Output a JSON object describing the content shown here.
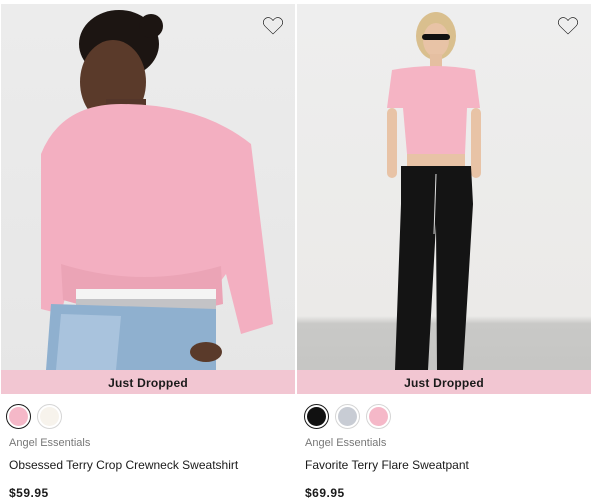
{
  "products": [
    {
      "badge": "Just Dropped",
      "brand": "Angel Essentials",
      "name": "Obsessed Terry Crop Crewneck Sweatshirt",
      "price": "$59.95",
      "favorite_icon": "heart-outline-icon",
      "swatches": [
        {
          "color": "#f5b8c8",
          "selected": true
        },
        {
          "color": "#f7f3ec",
          "selected": false
        }
      ]
    },
    {
      "badge": "Just Dropped",
      "brand": "Angel Essentials",
      "name": "Favorite Terry Flare Sweatpant",
      "price": "$69.95",
      "favorite_icon": "heart-outline-icon",
      "swatches": [
        {
          "color": "#111111",
          "selected": true
        },
        {
          "color": "#c8ccd4",
          "selected": false
        },
        {
          "color": "#f5b8c8",
          "selected": false
        }
      ]
    }
  ]
}
